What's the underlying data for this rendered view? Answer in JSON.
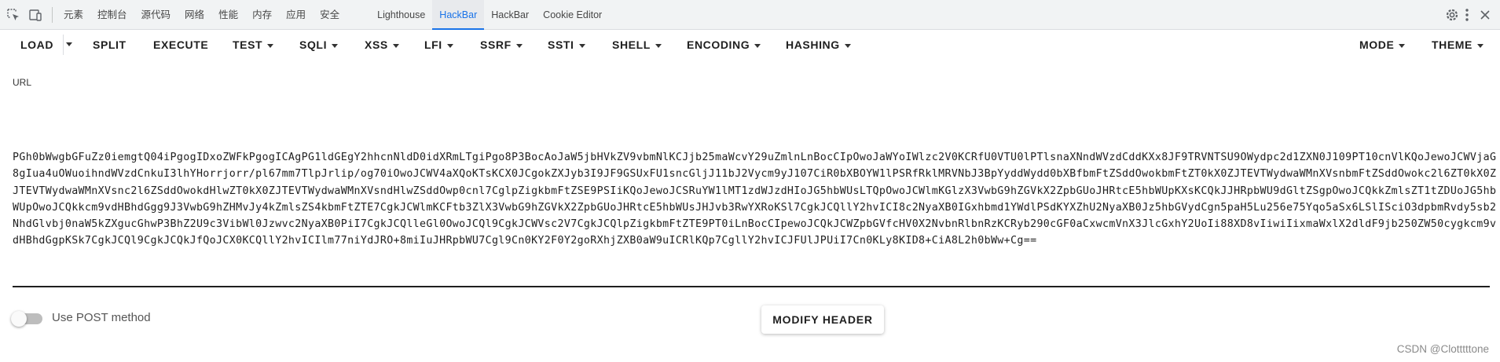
{
  "devtools": {
    "tabs": [
      {
        "label": "元素"
      },
      {
        "label": "控制台"
      },
      {
        "label": "源代码"
      },
      {
        "label": "网络"
      },
      {
        "label": "性能"
      },
      {
        "label": "内存"
      },
      {
        "label": "应用"
      },
      {
        "label": "安全"
      },
      {
        "label": "Lighthouse"
      },
      {
        "label": "HackBar"
      },
      {
        "label": "HackBar"
      },
      {
        "label": "Cookie Editor"
      }
    ],
    "active_tab_index": 9,
    "icons": {
      "inspect": "inspect-element-icon",
      "device": "device-toggle-icon",
      "settings": "gear-icon",
      "more": "more-vertical-icon",
      "close": "close-icon"
    }
  },
  "hackbar": {
    "menu": {
      "load": "LOAD",
      "split": "SPLIT",
      "execute": "EXECUTE",
      "test": "TEST",
      "sqli": "SQLI",
      "xss": "XSS",
      "lfi": "LFI",
      "ssrf": "SSRF",
      "ssti": "SSTI",
      "shell": "SHELL",
      "encoding": "ENCODING",
      "hashing": "HASHING",
      "mode": "MODE",
      "theme": "THEME"
    },
    "url_label": "URL",
    "url_value": "PGh0bWwgbGFuZz0iemgtQ04iPgogIDxoZWFkPgogICAgPG1ldGEgY2hhcnNldD0idXRmLTgiPgo8P3BocAoJaW5jbHVkZV9vbmNlKCJjb25maWcvY29uZmlnLnBocCIpOwoJaWYoIWlzc2V0KCRfU0VTU0lPTlsnaXNndWVzdCddKXx8JF9TRVNTSU9OWydpc2d1ZXN0J109PT10cnVlKQoJewoJCWVjaG8gIua4uOWuoihndWVzdCnkuI3lhYHorrjorr/pl67mm7TlpJrlip/og70iOwoJCWV4aXQoKTsKCX0JCgokZXJyb3I9JF9GSUxFU1sncGljJ11bJ2Vycm9yJ107CiR0bXBOYW1lPSRfRklMRVNbJ3BpYyddWydd0bXBfbmFtZSddOwokbmFtZT0kX0ZJTEVTWydwaWMnXVsnbmFtZSddOwokc2l6ZT0kX0ZJTEVTWydwaWMnXVsnc2l6ZSddOwokdHlwZT0kX0ZJTEVTWydwaWMnXVsndHlwZSddOwp0cnl7CglpZigkbmFtZSE9PSIiKQoJewoJCSRuYW1lMT1zdWJzdHIoJG5hbWUsLTQpOwoJCWlmKGlzX3VwbG9hZGVkX2ZpbGUoJHRtcE5hbWUpKXsKCQkJJHRpbWU9dGltZSgpOwoJCQkkZmlsZT1tZDUoJG5hbWUpOwoJCQkkcm9vdHBhdGgg9J3VwbG9hZHMvJy4kZmlsZS4kbmFtZTE7CgkJCWlmKCFtb3ZlX3VwbG9hZGVkX2ZpbGUoJHRtcE5hbWUsJHJvb3RwYXRoKSl7CgkJCQllY2hvICI8c2NyaXB0IGxhbmd1YWdlPSdKYXZhU2NyaXB0Jz5hbGVydCgn5paH5Lu256e75Yqo5aSx6LSlISciO3dpbmRvdy5sb2NhdGlvbj0naW5kZXguc GhwP3BhZ2U9c3VibWl0Jzwvc2NyaXB0PiI7CgkJCQlleGl0OwoJCQl9CgkJCWVsc2V7CgkJCQlpZigkbmFtZTE9PT0iLnBocCIpewoJCQkJCWZpbGVfcHV0X2NvbnRlbnRzKCRyb290cGF0aCxwcmVnX3JlcGxhY2UoIi88XD8vIiwiIixmaWxlX2dldF9jb250ZW50cygkcm9vdHBhdGgpKSk7CgkJCQl9CgkJCQkJfQoJCX0KCQllY2hvICIlm77niYdJRO+8miIuJHRpbWU7Cgl9Cn0KY2F0Y2goRXhjZXB0aW9uICRlKQp7CgllY2hvICJFUlJPUiI7Cn0KLy8KID8+CiA8L2h0bWw+Cg==",
    "post_toggle_label": "Use POST method",
    "modify_header_label": "MODIFY HEADER"
  },
  "watermark": "CSDN @Clotttttone"
}
